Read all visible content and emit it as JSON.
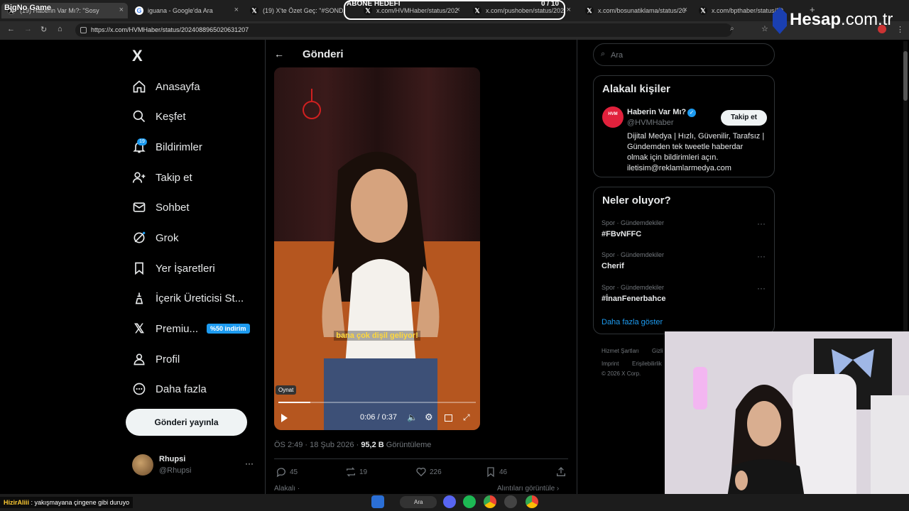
{
  "browser": {
    "tabs": [
      {
        "title": "(19) Haberin Var Mı?: \"Sosy",
        "close": "×"
      },
      {
        "title": "iguana - Google'da Ara",
        "close": "×"
      },
      {
        "title": "(19) X'te Özet Geç: \"#SONDAKİ",
        "close": "×"
      },
      {
        "title": "x.com/HVMHaber/status/202",
        "close": "×"
      },
      {
        "title": "x.com/pushoben/status/202",
        "close": "×"
      },
      {
        "title": "x.com/bosunatiklama/status/20",
        "close": "×"
      },
      {
        "title": "x.com/bpthaber/status/20",
        "close": "×"
      }
    ],
    "url": "https://x.com/HVMHaber/status/2024088965020631207",
    "new_tab": "+"
  },
  "overlay": {
    "goal_title": "ABONE HEDEFİ",
    "goal_count": "0 / 10",
    "watermark_main": "Hesap",
    "watermark_suffix": ".com.tr",
    "stream_logo": "BigNo Game"
  },
  "sidebar": {
    "logo": "X",
    "items": [
      {
        "label": "Anasayfa",
        "icon": "home-icon"
      },
      {
        "label": "Keşfet",
        "icon": "search-icon"
      },
      {
        "label": "Bildirimler",
        "icon": "bell-icon"
      },
      {
        "label": "Takip et",
        "icon": "follow-icon"
      },
      {
        "label": "Sohbet",
        "icon": "mail-icon"
      },
      {
        "label": "Grok",
        "icon": "grok-icon"
      },
      {
        "label": "Yer İşaretleri",
        "icon": "bookmark-icon"
      },
      {
        "label": "İçerik Üreticisi St...",
        "icon": "creator-icon"
      },
      {
        "label": "Premiu...",
        "icon": "x-premium-icon"
      },
      {
        "label": "Profil",
        "icon": "person-icon"
      },
      {
        "label": "Daha fazla",
        "icon": "more-icon"
      }
    ],
    "notif_count": "19",
    "premium_badge": "%50 indirim",
    "post_button": "Gönderi yayınla",
    "account": {
      "name": "Rhupsi",
      "handle": "@Rhupsi",
      "more": "···"
    }
  },
  "main": {
    "header_title": "Gönderi",
    "video": {
      "caption": "bana çok dişil geliyor!",
      "play_tooltip": "Oynat",
      "time": "0:06 / 0:37",
      "progress": 0.162
    },
    "meta": {
      "time": "ÖS 2:49 · 18 Şub 2026 · ",
      "views": "95,2 B",
      "views_label": "Görüntüleme"
    },
    "actions": {
      "replies": "45",
      "reposts": "19",
      "likes": "226",
      "bookmarks": "46"
    },
    "related_label": "Alakalı ·",
    "quotes_label": "Alıntıları görüntüle ›"
  },
  "right": {
    "search_placeholder": "Ara",
    "related": {
      "title": "Alakalı kişiler",
      "name": "Haberin Var Mı?",
      "handle": "@HVMHaber",
      "follow": "Takip et",
      "bio": [
        "Dijital Medya | Hızlı, Güvenilir, Tarafsız |",
        "Gündemden tek tweetle haberdar",
        "olmak için bildirimleri açın.",
        "iletisim@reklamlarmedya.com"
      ]
    },
    "trends": {
      "title": "Neler oluyor?",
      "items": [
        {
          "category": "Spor · Gündemdekiler",
          "name": "#FBvNFFC"
        },
        {
          "category": "Spor · Gündemdekiler",
          "name": "Cherif"
        },
        {
          "category": "Spor · Gündemdekiler",
          "name": "#İnanFenerbahce"
        }
      ],
      "show_more": "Daha fazla göster"
    },
    "footer": [
      "Hizmet Şartları",
      "Gizli",
      "Imprint",
      "Erişilebilirlik",
      "© 2026 X Corp."
    ]
  },
  "taskbar": {
    "search": "Ara",
    "chat_user": "HizirAliii",
    "chat_msg": " : yakışmayana çingene gibi duruyo"
  },
  "colors": {
    "accent": "#1d9bf0",
    "bg": "#000000",
    "border": "#2f3336",
    "muted": "#71767b"
  }
}
